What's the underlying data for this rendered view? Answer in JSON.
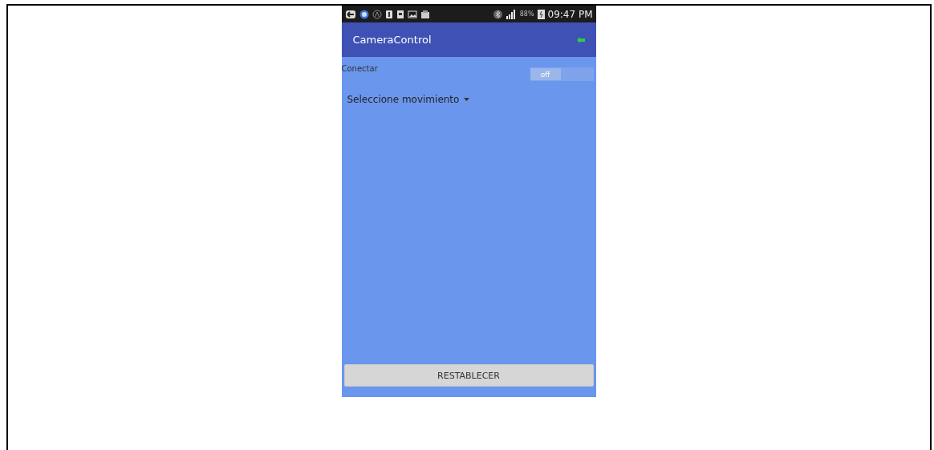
{
  "status_bar": {
    "battery_percent": "88%",
    "time": "09:47 PM"
  },
  "app_bar": {
    "title": "CameraControl"
  },
  "connect": {
    "label": "Conectar",
    "on": false,
    "switch_text": "off"
  },
  "movement_spinner": {
    "label": "Seleccione movimiento"
  },
  "reset_button": {
    "label": "RESTABLECER"
  }
}
